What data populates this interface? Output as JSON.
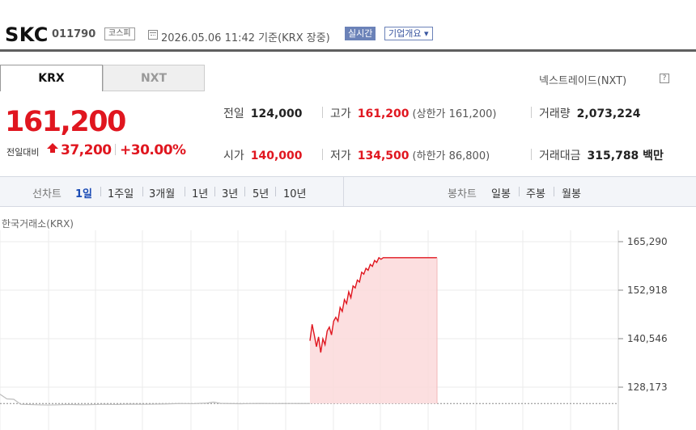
{
  "header": {
    "company": "SKC",
    "code": "011790",
    "market": "코스피",
    "datetime": "2026.05.06 11:42 기준(KRX 장중)",
    "realtime_label": "실시간",
    "corp_label": "기업개요 ▾",
    "icon": "calendar-icon"
  },
  "tabs": [
    {
      "label": "KRX"
    },
    {
      "label": "NXT"
    }
  ],
  "nextrade_link": "넥스트레이드(NXT)",
  "help_label": "?",
  "price": {
    "current": "161,200",
    "change_label": "전일대비",
    "change": "37,200",
    "change_rate": "+30.00%",
    "change_icon": "up-arrow-icon"
  },
  "stats": {
    "prev_close": {
      "label": "전일",
      "value": "124,000"
    },
    "high": {
      "label": "고가",
      "value": "161,200",
      "limit": "(상한가 161,200)"
    },
    "volume": {
      "label": "거래량",
      "value": "2,073,224"
    },
    "open": {
      "label": "시가",
      "value": "140,000"
    },
    "low": {
      "label": "저가",
      "value": "134,500",
      "limit": "(하한가 86,800)"
    },
    "amount": {
      "label": "거래대금",
      "value": "315,788 백만"
    }
  },
  "toolbar": {
    "line_label": "선차트",
    "line_periods": [
      "1일",
      "1주일",
      "3개월",
      "1년",
      "3년",
      "5년",
      "10년"
    ],
    "active_period": "1일",
    "candle_label": "봉차트",
    "candle_periods": [
      "일봉",
      "주봉",
      "월봉"
    ]
  },
  "colors": {
    "up": "#e0161f",
    "accent": "#1a4bb5",
    "fill": "#fbd9da"
  },
  "chart_data": {
    "type": "area",
    "title": "한국거래소(KRX)",
    "y_ticks": [
      "165,290",
      "152,918",
      "140,546",
      "128,173"
    ],
    "tick_values": [
      165290,
      152918,
      140546,
      128173
    ],
    "baseline": 124000,
    "grid": true,
    "series": [
      {
        "name": "",
        "segment": "prior",
        "values": [
          123900,
          123950,
          123850,
          123800,
          123750,
          123700,
          123650,
          123620,
          123650,
          123700,
          123750,
          123720,
          123680,
          123700,
          123750,
          123800,
          123780,
          123750,
          123800,
          123850,
          123820,
          123800,
          123830,
          123870,
          123900,
          123950,
          124000,
          123980,
          123960,
          124050,
          124100,
          124350,
          124050,
          124000,
          123970,
          123950,
          123980,
          124000,
          124020,
          124000,
          123980,
          123990,
          124010,
          124000,
          124000,
          124000
        ]
      },
      {
        "name": "",
        "segment": "today",
        "values": [
          140000,
          144200,
          141500,
          138500,
          141000,
          137000,
          140500,
          139000,
          142500,
          143500,
          141500,
          145000,
          146000,
          145000,
          148500,
          147500,
          150500,
          149500,
          152500,
          151000,
          154000,
          153500,
          155500,
          155000,
          157500,
          157000,
          158500,
          158000,
          159500,
          159000,
          160500,
          160000,
          161200,
          160800,
          161200,
          161200,
          161200,
          161200,
          161200,
          161200,
          161200,
          161200,
          161200,
          161200,
          161200,
          161200,
          161200,
          161200,
          161200,
          161200,
          161200,
          161200,
          161200,
          161200,
          161200,
          161200,
          161200,
          161200,
          161200,
          161200
        ]
      }
    ]
  }
}
